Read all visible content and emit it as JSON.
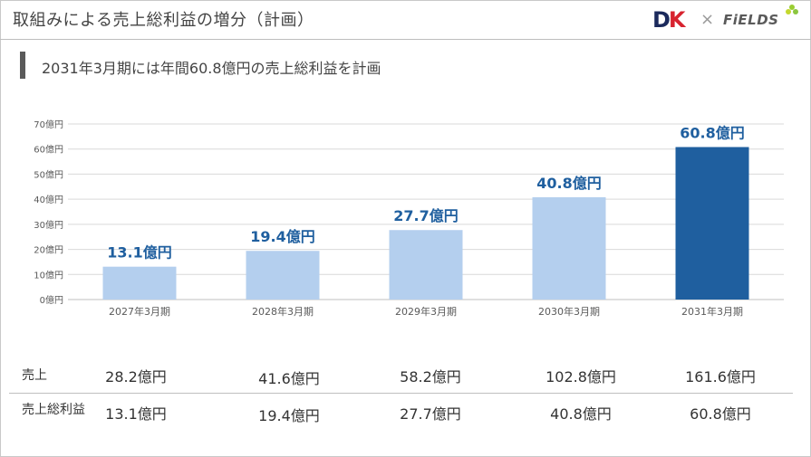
{
  "header": {
    "title": "取組みによる売上総利益の増分（計画）",
    "logo_dk_d": "D",
    "logo_dk_k": "K",
    "logo_separator": "×",
    "logo_fields": "FiELDS"
  },
  "subtitle": "2031年3月期には年間60.8億円の売上総利益を計画",
  "chart_data": {
    "type": "bar",
    "categories": [
      "2027年3月期",
      "2028年3月期",
      "2029年3月期",
      "2030年3月期",
      "2031年3月期"
    ],
    "values": [
      13.1,
      19.4,
      27.7,
      40.8,
      60.8
    ],
    "data_labels": [
      "13.1億円",
      "19.4億円",
      "27.7億円",
      "40.8億円",
      "60.8億円"
    ],
    "ylim": [
      0,
      70
    ],
    "y_ticks": [
      "0億円",
      "10億円",
      "20億円",
      "30億円",
      "40億円",
      "50億円",
      "60億円",
      "70億円"
    ],
    "grid": true,
    "colors": {
      "default_bar": "#b4cfee",
      "highlight_bar": "#1f5f9f",
      "data_label": "#1f5f9f",
      "grid": "#d9d9d9"
    },
    "highlight_index": 4
  },
  "table": {
    "rows": [
      {
        "label": "売上",
        "values": [
          "28.2億円",
          "41.6億円",
          "58.2億円",
          "102.8億円",
          "161.6億円"
        ]
      },
      {
        "label": "売上総利益",
        "values": [
          "13.1億円",
          "19.4億円",
          "27.7億円",
          "40.8億円",
          "60.8億円"
        ]
      }
    ]
  }
}
